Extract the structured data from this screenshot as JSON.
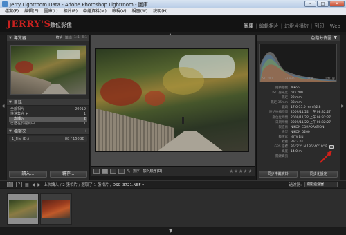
{
  "window": {
    "title": "Jerry Lightroom Data - Adobe Photoshop Lightroom - 圖庫",
    "buttons": {
      "minimize": "–",
      "maximize": "□",
      "close": "✕"
    }
  },
  "menu": [
    "檔案(F)",
    "編輯(E)",
    "圖庫(L)",
    "相片(P)",
    "中繼資料(M)",
    "檢視(V)",
    "視窗(W)",
    "說明(H)"
  ],
  "brand": {
    "logo": "JERRY'S",
    "subtitle": "數位影像"
  },
  "modules": [
    "圖庫",
    "編輯相片",
    "幻燈片播放",
    "列印",
    "Web"
  ],
  "navigator": {
    "title": "導覽器",
    "zoom_options": [
      "符合",
      "填滿",
      "1:1",
      "3:1"
    ]
  },
  "catalog": {
    "title": "目錄",
    "items": [
      {
        "label": "全部相片",
        "count": "20019"
      },
      {
        "label": "快速集合 +",
        "count": "1"
      },
      {
        "label": "上次讀入",
        "count": "2"
      },
      {
        "label": "已歷在於檔目中",
        "count": "1"
      }
    ]
  },
  "folders": {
    "title": "檔案夾",
    "row": {
      "label": "1_File (D:)",
      "value": "88 / 150GB"
    }
  },
  "left_buttons": {
    "import": "讀入...",
    "export": "轉存..."
  },
  "toolbar": {
    "sort_label": "排序:",
    "sort_value": "加入順序(O)",
    "stars": "★★★★★"
  },
  "histogram": {
    "title": "色階分佈圖",
    "info": [
      "ISO 200",
      "33 mm",
      "f/2.8",
      "1/60 秒"
    ]
  },
  "metadata": [
    {
      "k": "拍攝相機",
      "v": "Nikon"
    },
    {
      "k": "ISO 感光度",
      "v": "ISO 200"
    },
    {
      "k": "焦距",
      "v": "22 mm"
    },
    {
      "k": "焦距 35mm",
      "v": "33 mm"
    },
    {
      "k": "鏡頭",
      "v": "17.0-55.0 mm f/2.8"
    },
    {
      "k": "原始拍攝時間",
      "v": "2009/11/22 上午 08:32:27"
    },
    {
      "k": "數位化時間",
      "v": "2009/11/22 上午 08:32:27"
    },
    {
      "k": "日期時間",
      "v": "2009/11/22 上午 08:32:27"
    },
    {
      "k": "製造商",
      "v": "NIKON CORPORATION"
    },
    {
      "k": "機型",
      "v": "NIKON D200"
    },
    {
      "k": "藝術家",
      "v": "Jerry Liu"
    },
    {
      "k": "軟體",
      "v": "Ver.2.01"
    },
    {
      "k": "GPS 座標",
      "v": "35°2'2\" N 135°40'19\" E"
    },
    {
      "k": "高度",
      "v": "14.0 m"
    },
    {
      "k": "關鍵資訊",
      "v": ""
    }
  ],
  "right_buttons": {
    "sync_metadata": "同步中繼資料",
    "sync_settings": "同步化設定"
  },
  "filmstrip": {
    "pages": [
      "1",
      "2"
    ],
    "path_prefix": "上次讀入 / 2 張相片 / 選取了 1 張相片 /",
    "filename": "DSC_3721.NEF",
    "filter_label": "過濾器:",
    "filter_value": "關閉過濾器"
  }
}
